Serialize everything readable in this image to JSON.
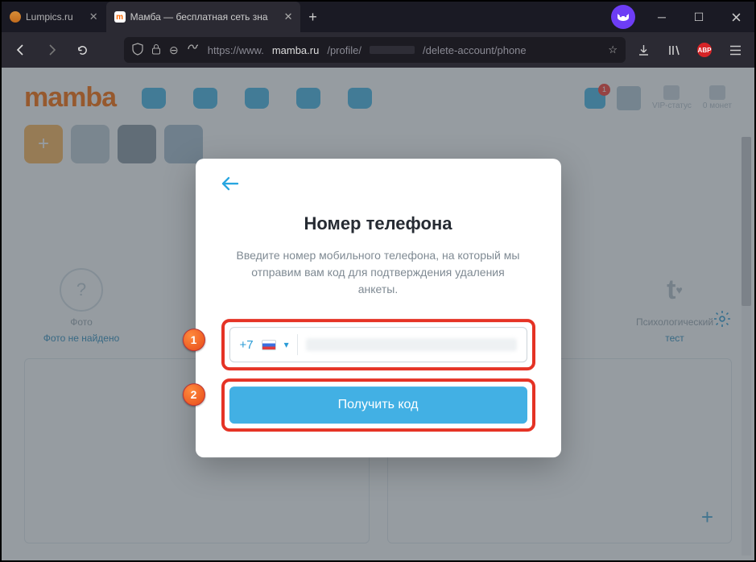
{
  "browser": {
    "tabs": [
      {
        "title": "Lumpics.ru"
      },
      {
        "title": "Мамба — бесплатная сеть зна"
      }
    ],
    "url_prefix": "https://www.",
    "url_domain": "mamba.ru",
    "url_path_a": "/profile/",
    "url_path_b": "/delete-account/phone",
    "new_tab": "+"
  },
  "nav": {
    "logo": "mamba",
    "notif_count": "1",
    "vip_label": "VIP-статус",
    "coins_label": "0 монет"
  },
  "cards": {
    "photo_label": "Фото",
    "photo_link": "Фото не найдено",
    "test_label": "Психологический",
    "test_link": "тест"
  },
  "modal": {
    "title": "Номер телефона",
    "description": "Введите номер мобильного телефона, на который мы отправим вам код для подтверждения удаления анкеты.",
    "country_code": "+7",
    "submit": "Получить код"
  },
  "callouts": {
    "one": "1",
    "two": "2"
  }
}
